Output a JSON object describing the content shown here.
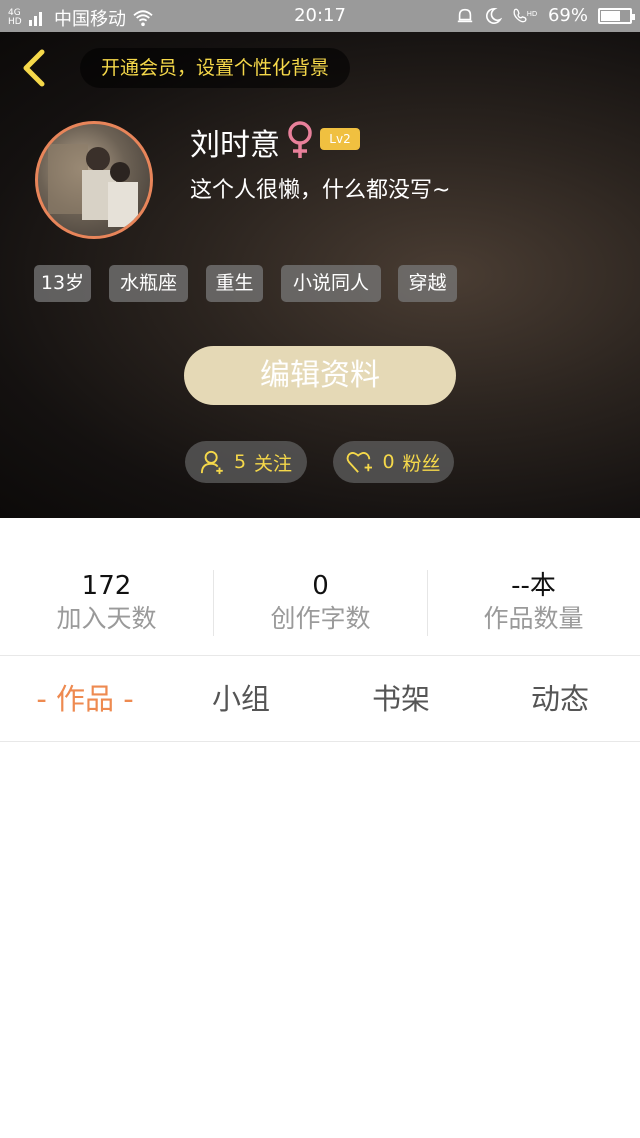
{
  "status_bar": {
    "network_type": "4G HD",
    "carrier": "中国移动",
    "time": "20:17",
    "battery": "69%",
    "battery_level": 0.69
  },
  "header": {
    "vip_banner": "开通会员，设置个性化背景",
    "username": "刘时意",
    "level": "Lv2",
    "bio": "这个人很懒，什么都没写~",
    "tags": [
      "13岁",
      "水瓶座",
      "重生",
      "小说同人",
      "穿越"
    ],
    "edit_button": "编辑资料",
    "following": {
      "count": "5",
      "label": "关注"
    },
    "fans": {
      "count": "0",
      "label": "粉丝"
    }
  },
  "stats": [
    {
      "value": "172",
      "label": "加入天数"
    },
    {
      "value": "0",
      "label": "创作字数"
    },
    {
      "value": "--本",
      "label": "作品数量"
    }
  ],
  "tabs": {
    "active_text": "- 作品 -",
    "items": [
      "作品",
      "小组",
      "书架",
      "动态"
    ]
  },
  "colors": {
    "accent": "#ee8a50",
    "gold": "#f5d84a",
    "edit_button_bg": "#e5d9b6",
    "level_badge_bg": "#f0c040"
  }
}
